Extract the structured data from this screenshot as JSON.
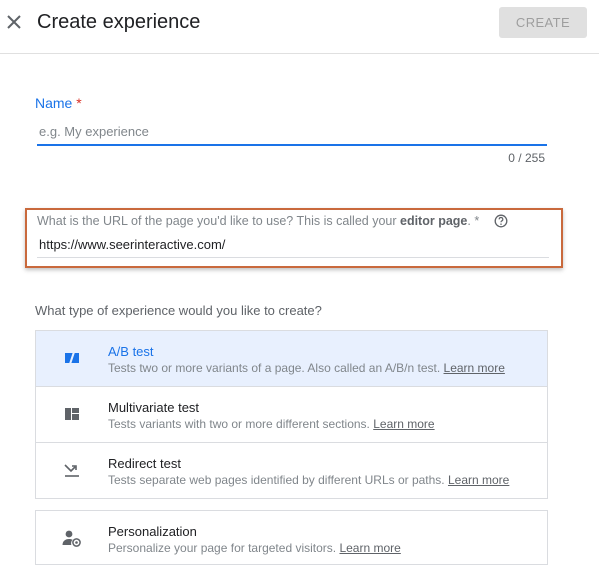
{
  "header": {
    "title": "Create experience",
    "create_label": "CREATE"
  },
  "name_field": {
    "label": "Name",
    "required_mark": "*",
    "placeholder": "e.g. My experience",
    "value": "",
    "counter": "0 / 255"
  },
  "url_field": {
    "label_prefix": "What is the URL of the page you'd like to use? This is called your ",
    "label_bold": "editor page",
    "label_suffix": ". *",
    "value": "https://www.seerinteractive.com/"
  },
  "experience_question": "What type of experience would you like to create?",
  "experience_types": [
    {
      "title": "A/B test",
      "description": "Tests two or more variants of a page. Also called an A/B/n test. ",
      "link": "Learn more",
      "icon": "ab-test-icon",
      "selected": true
    },
    {
      "title": "Multivariate test",
      "description": "Tests variants with two or more different sections. ",
      "link": "Learn more",
      "icon": "multivariate-icon",
      "selected": false
    },
    {
      "title": "Redirect test",
      "description": "Tests separate web pages identified by different URLs or paths. ",
      "link": "Learn more",
      "icon": "redirect-icon",
      "selected": false
    }
  ],
  "personalization": {
    "title": "Personalization",
    "description": "Personalize your page for targeted visitors. ",
    "link": "Learn more",
    "icon": "personalization-icon"
  },
  "colors": {
    "accent": "#1a73e8",
    "required": "#d93025",
    "highlight_border": "#c9693c",
    "selected_bg": "#e8f0fe"
  }
}
